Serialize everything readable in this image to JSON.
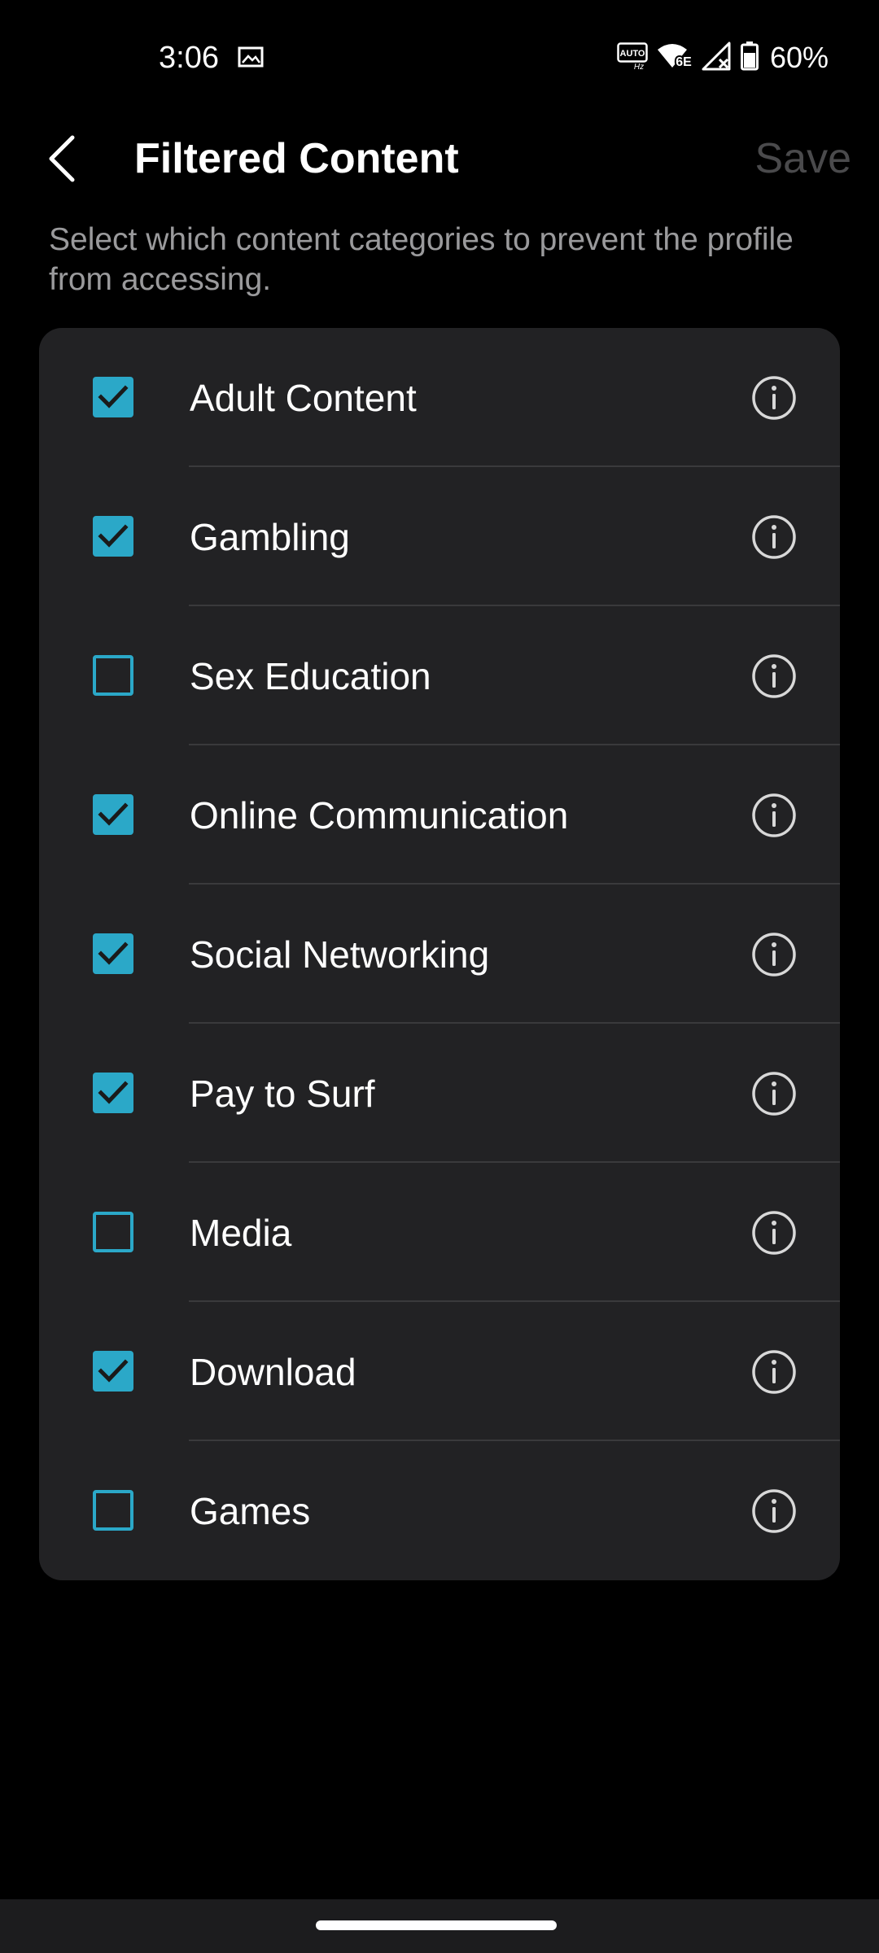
{
  "status_bar": {
    "time": "3:06",
    "battery": "60%",
    "icons": [
      "gallery-icon",
      "auto-hz-icon",
      "wifi-6e-icon",
      "signal-icon",
      "battery-icon"
    ],
    "auto_label": "AUTO",
    "hz_label": "Hz",
    "wifi_label": "6E"
  },
  "header": {
    "back_icon": "chevron-left-icon",
    "title": "Filtered Content",
    "save_label": "Save"
  },
  "description": "Select which content categories to prevent the profile from accessing.",
  "categories": [
    {
      "label": "Adult Content",
      "checked": true
    },
    {
      "label": "Gambling",
      "checked": true
    },
    {
      "label": "Sex Education",
      "checked": false
    },
    {
      "label": "Online Communication",
      "checked": true
    },
    {
      "label": "Social Networking",
      "checked": true
    },
    {
      "label": "Pay to Surf",
      "checked": true
    },
    {
      "label": "Media",
      "checked": false
    },
    {
      "label": "Download",
      "checked": true
    },
    {
      "label": "Games",
      "checked": false
    }
  ],
  "colors": {
    "accent": "#2ba8c8",
    "card_bg": "#222224",
    "background": "#000000",
    "save_disabled": "#4a4a4c",
    "description_text": "#9a9a9c"
  }
}
